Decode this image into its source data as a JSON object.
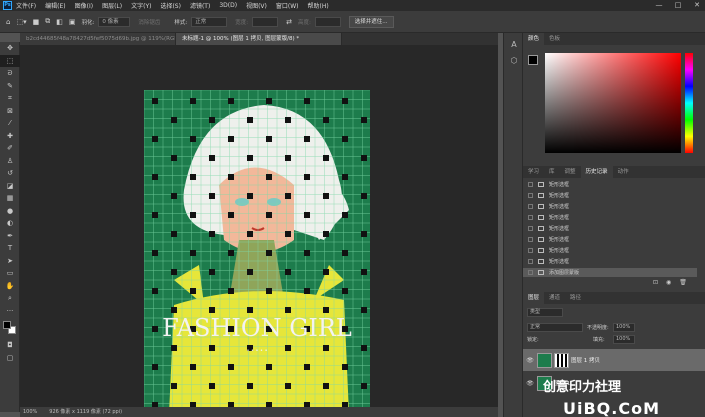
{
  "app": {
    "logo": "Ps"
  },
  "menu": [
    "文件(F)",
    "编辑(E)",
    "图像(I)",
    "图层(L)",
    "文字(Y)",
    "选择(S)",
    "滤镜(T)",
    "3D(D)",
    "视图(V)",
    "窗口(W)",
    "帮助(H)"
  ],
  "window_controls": [
    "—",
    "□",
    "✕"
  ],
  "options": {
    "feather_label": "羽化:",
    "feather_value": "0 像素",
    "antialias_label": "消除锯齿",
    "style_label": "样式:",
    "style_value": "正常",
    "width_label": "宽度:",
    "height_label": "高度:",
    "select_subject": "选择并遮住..."
  },
  "tabs": [
    {
      "label": "b2cd44685f48a78427d5fef5075d69b.jpg @ 119%(RGB/8#)"
    },
    {
      "label": "未标题-1 @ 100% (图层 1 拷贝, 图层蒙版/8) *",
      "active": true
    }
  ],
  "canvas_text": {
    "title": "FASHION GIRL",
    "sub": "• • • • •"
  },
  "status": {
    "zoom": "100%",
    "doc": "926 像素 x 1119 像素 (72 ppi)"
  },
  "color_panel": {
    "tabs": [
      "颜色",
      "色板"
    ]
  },
  "history_panel": {
    "tabs": [
      "学习",
      "库",
      "调整",
      "历史记录",
      "动作"
    ],
    "active_tab": 3,
    "items": [
      "矩形选框",
      "矩形选框",
      "矩形选框",
      "矩形选框",
      "矩形选框",
      "矩形选框",
      "矩形选框",
      "矩形选框",
      "添加图层蒙版"
    ]
  },
  "layers_panel": {
    "tabs": [
      "图层",
      "通道",
      "路径"
    ],
    "kind_label": "类型",
    "blend_mode": "正常",
    "opacity_label": "不透明度:",
    "opacity_value": "100%",
    "lock_label": "锁定:",
    "fill_label": "填充:",
    "fill_value": "100%",
    "layers": [
      {
        "name": "图层 1 拷贝"
      },
      {
        "name": "图层 1"
      }
    ]
  },
  "watermark": {
    "brand": "UiBQ.CoM",
    "cn": "创意印力社理"
  },
  "colors": {
    "canvas_green": "#1d7c4c",
    "grid": "#7fd8a8",
    "yellow": "#e6e63a"
  }
}
